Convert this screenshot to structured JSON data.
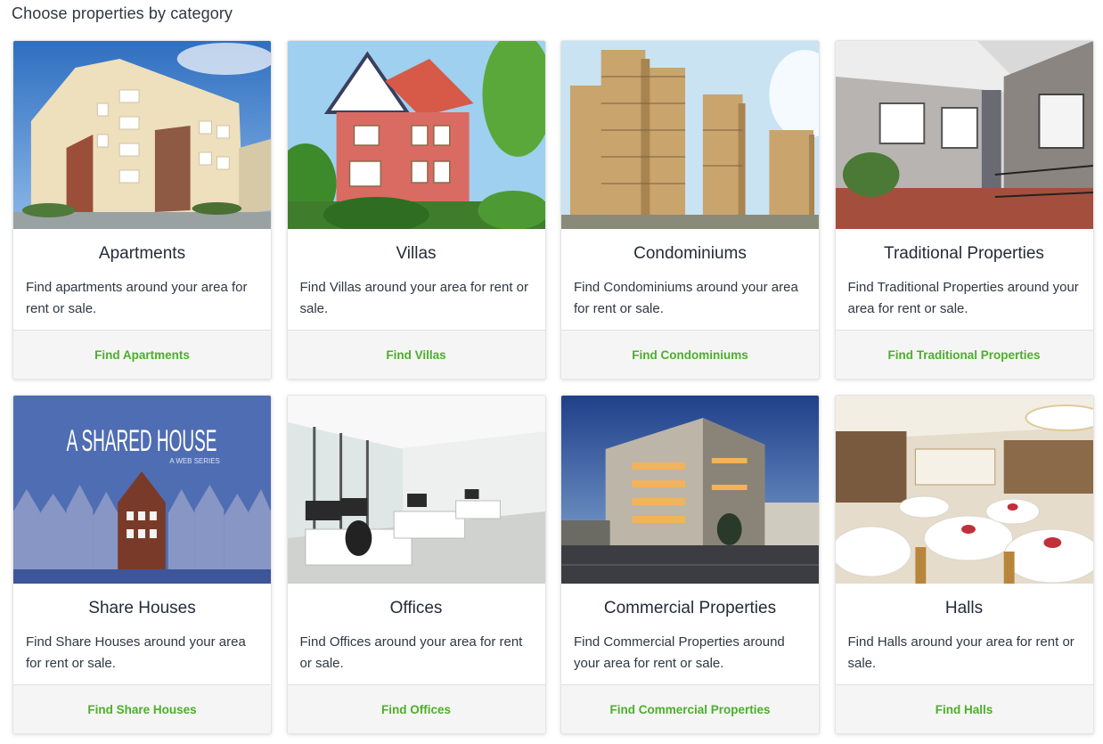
{
  "page": {
    "heading": "Choose properties by category"
  },
  "categories": [
    {
      "title": "Apartments",
      "description": "Find apartments around your area for rent or sale.",
      "link": "Find Apartments",
      "image_icon": "apartment-building-photo"
    },
    {
      "title": "Villas",
      "description": "Find Villas around your area for rent or sale.",
      "link": "Find Villas",
      "image_icon": "villa-house-photo"
    },
    {
      "title": "Condominiums",
      "description": "Find Condominiums around your area for rent or sale.",
      "link": "Find Condominiums",
      "image_icon": "condominium-towers-photo"
    },
    {
      "title": "Traditional Properties",
      "description": "Find Traditional Properties around your area for rent or sale.",
      "link": "Find Traditional Properties",
      "image_icon": "traditional-house-photo"
    },
    {
      "title": "Share Houses",
      "description": "Find Share Houses around your area for rent or sale.",
      "link": "Find Share Houses",
      "image_icon": "shared-house-poster",
      "image_text": "A SHARED HOUSE",
      "image_subtext": "A WEB SERIES"
    },
    {
      "title": "Offices",
      "description": "Find Offices around your area for rent or sale.",
      "link": "Find Offices",
      "image_icon": "office-interior-photo"
    },
    {
      "title": "Commercial Properties",
      "description": "Find Commercial Properties around your area for rent or sale.",
      "link": "Find Commercial Properties",
      "image_icon": "commercial-building-photo"
    },
    {
      "title": "Halls",
      "description": "Find Halls around your area for rent or sale.",
      "link": "Find Halls",
      "image_icon": "banquet-hall-photo"
    }
  ],
  "colors": {
    "link": "#4caf2a",
    "footer_bg": "#f5f5f5",
    "title_text": "#242c38"
  }
}
